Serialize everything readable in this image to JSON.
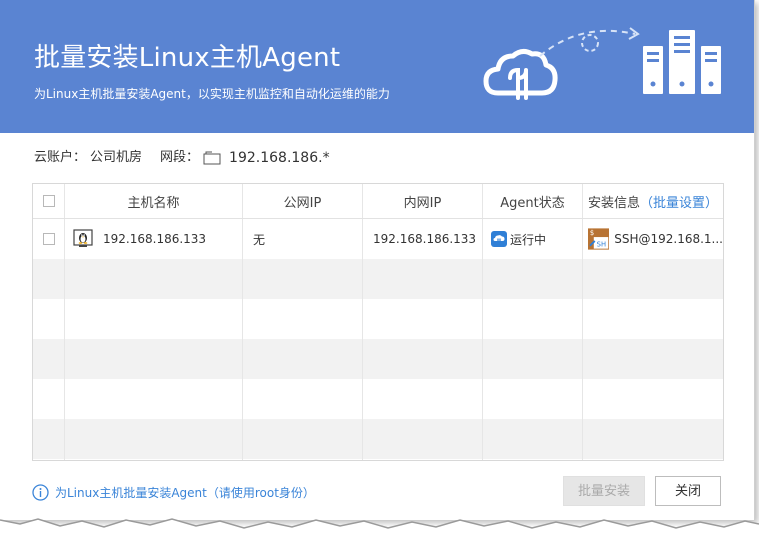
{
  "header": {
    "title": "批量安装Linux主机Agent",
    "subtitle": "为Linux主机批量安装Agent，以实现主机监控和自动化运维的能力"
  },
  "meta": {
    "cloud_account_label": "云账户：",
    "cloud_account_value": "公司机房",
    "subnet_label": "网段：",
    "subnet_value": "192.168.186.*"
  },
  "table": {
    "headers": {
      "host_name": "主机名称",
      "public_ip": "公网IP",
      "private_ip": "内网IP",
      "agent_status": "Agent状态",
      "install_info": "安装信息",
      "bulk_settings_open": "（",
      "bulk_settings": "批量设置",
      "bulk_settings_close": "）"
    },
    "rows": [
      {
        "host_name": "192.168.186.133",
        "public_ip": "无",
        "private_ip": "192.168.186.133",
        "agent_status": "运行中",
        "install_info": "SSH@192.168.1..."
      }
    ]
  },
  "footer": {
    "info_text": "为Linux主机批量安装Agent（请使用root身份）",
    "install_button": "批量安装",
    "close_button": "关闭"
  },
  "colors": {
    "header_bg": "#5a84d2",
    "link": "#3a84d8",
    "stripe": "#f2f2f2"
  },
  "icons": {
    "header_art": "cloud-server-icon",
    "subnet": "folder-icon",
    "host": "linux-penguin-icon",
    "status": "agent-running-icon",
    "install": "ssh-icon",
    "info": "info-icon"
  }
}
